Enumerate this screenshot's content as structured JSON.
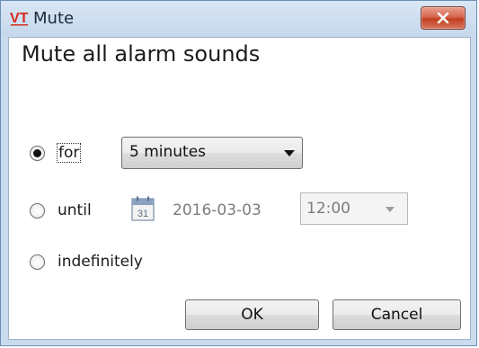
{
  "window": {
    "title": "Mute",
    "app_icon": "vt-logo-icon",
    "close_icon": "close-icon"
  },
  "dialog": {
    "heading": "Mute all alarm sounds",
    "options": [
      {
        "label": "for",
        "selected": true
      },
      {
        "label": "until",
        "selected": false
      },
      {
        "label": "indefinitely",
        "selected": false
      }
    ],
    "duration_dropdown": {
      "value": "5 minutes"
    },
    "until_date": {
      "value": "2016-03-03",
      "icon": "calendar-icon",
      "calendar_day": "31"
    },
    "until_time": {
      "value": "12:00"
    },
    "buttons": {
      "ok": "OK",
      "cancel": "Cancel"
    }
  },
  "colors": {
    "titlebar": "#c9dbed",
    "close_button": "#c7452b",
    "disabled_text": "#7d7d7d"
  }
}
